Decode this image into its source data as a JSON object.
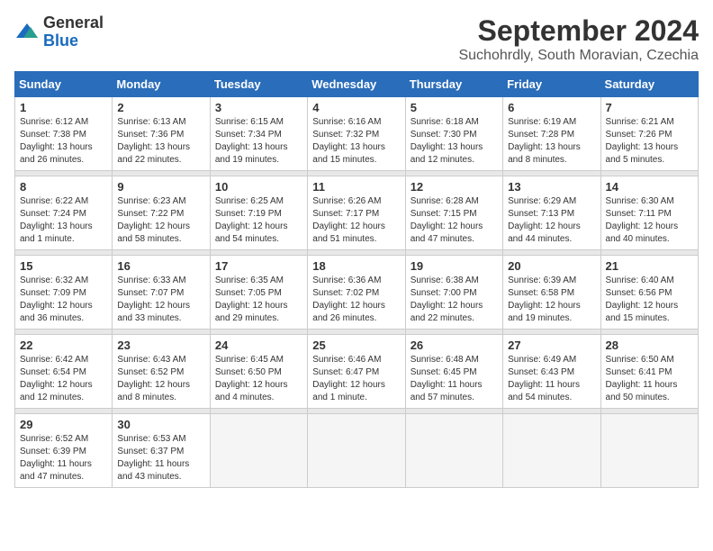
{
  "logo": {
    "general": "General",
    "blue": "Blue"
  },
  "title": "September 2024",
  "location": "Suchohrdly, South Moravian, Czechia",
  "days_of_week": [
    "Sunday",
    "Monday",
    "Tuesday",
    "Wednesday",
    "Thursday",
    "Friday",
    "Saturday"
  ],
  "weeks": [
    [
      {
        "day": 1,
        "info": "Sunrise: 6:12 AM\nSunset: 7:38 PM\nDaylight: 13 hours\nand 26 minutes."
      },
      {
        "day": 2,
        "info": "Sunrise: 6:13 AM\nSunset: 7:36 PM\nDaylight: 13 hours\nand 22 minutes."
      },
      {
        "day": 3,
        "info": "Sunrise: 6:15 AM\nSunset: 7:34 PM\nDaylight: 13 hours\nand 19 minutes."
      },
      {
        "day": 4,
        "info": "Sunrise: 6:16 AM\nSunset: 7:32 PM\nDaylight: 13 hours\nand 15 minutes."
      },
      {
        "day": 5,
        "info": "Sunrise: 6:18 AM\nSunset: 7:30 PM\nDaylight: 13 hours\nand 12 minutes."
      },
      {
        "day": 6,
        "info": "Sunrise: 6:19 AM\nSunset: 7:28 PM\nDaylight: 13 hours\nand 8 minutes."
      },
      {
        "day": 7,
        "info": "Sunrise: 6:21 AM\nSunset: 7:26 PM\nDaylight: 13 hours\nand 5 minutes."
      }
    ],
    [
      {
        "day": 8,
        "info": "Sunrise: 6:22 AM\nSunset: 7:24 PM\nDaylight: 13 hours\nand 1 minute."
      },
      {
        "day": 9,
        "info": "Sunrise: 6:23 AM\nSunset: 7:22 PM\nDaylight: 12 hours\nand 58 minutes."
      },
      {
        "day": 10,
        "info": "Sunrise: 6:25 AM\nSunset: 7:19 PM\nDaylight: 12 hours\nand 54 minutes."
      },
      {
        "day": 11,
        "info": "Sunrise: 6:26 AM\nSunset: 7:17 PM\nDaylight: 12 hours\nand 51 minutes."
      },
      {
        "day": 12,
        "info": "Sunrise: 6:28 AM\nSunset: 7:15 PM\nDaylight: 12 hours\nand 47 minutes."
      },
      {
        "day": 13,
        "info": "Sunrise: 6:29 AM\nSunset: 7:13 PM\nDaylight: 12 hours\nand 44 minutes."
      },
      {
        "day": 14,
        "info": "Sunrise: 6:30 AM\nSunset: 7:11 PM\nDaylight: 12 hours\nand 40 minutes."
      }
    ],
    [
      {
        "day": 15,
        "info": "Sunrise: 6:32 AM\nSunset: 7:09 PM\nDaylight: 12 hours\nand 36 minutes."
      },
      {
        "day": 16,
        "info": "Sunrise: 6:33 AM\nSunset: 7:07 PM\nDaylight: 12 hours\nand 33 minutes."
      },
      {
        "day": 17,
        "info": "Sunrise: 6:35 AM\nSunset: 7:05 PM\nDaylight: 12 hours\nand 29 minutes."
      },
      {
        "day": 18,
        "info": "Sunrise: 6:36 AM\nSunset: 7:02 PM\nDaylight: 12 hours\nand 26 minutes."
      },
      {
        "day": 19,
        "info": "Sunrise: 6:38 AM\nSunset: 7:00 PM\nDaylight: 12 hours\nand 22 minutes."
      },
      {
        "day": 20,
        "info": "Sunrise: 6:39 AM\nSunset: 6:58 PM\nDaylight: 12 hours\nand 19 minutes."
      },
      {
        "day": 21,
        "info": "Sunrise: 6:40 AM\nSunset: 6:56 PM\nDaylight: 12 hours\nand 15 minutes."
      }
    ],
    [
      {
        "day": 22,
        "info": "Sunrise: 6:42 AM\nSunset: 6:54 PM\nDaylight: 12 hours\nand 12 minutes."
      },
      {
        "day": 23,
        "info": "Sunrise: 6:43 AM\nSunset: 6:52 PM\nDaylight: 12 hours\nand 8 minutes."
      },
      {
        "day": 24,
        "info": "Sunrise: 6:45 AM\nSunset: 6:50 PM\nDaylight: 12 hours\nand 4 minutes."
      },
      {
        "day": 25,
        "info": "Sunrise: 6:46 AM\nSunset: 6:47 PM\nDaylight: 12 hours\nand 1 minute."
      },
      {
        "day": 26,
        "info": "Sunrise: 6:48 AM\nSunset: 6:45 PM\nDaylight: 11 hours\nand 57 minutes."
      },
      {
        "day": 27,
        "info": "Sunrise: 6:49 AM\nSunset: 6:43 PM\nDaylight: 11 hours\nand 54 minutes."
      },
      {
        "day": 28,
        "info": "Sunrise: 6:50 AM\nSunset: 6:41 PM\nDaylight: 11 hours\nand 50 minutes."
      }
    ],
    [
      {
        "day": 29,
        "info": "Sunrise: 6:52 AM\nSunset: 6:39 PM\nDaylight: 11 hours\nand 47 minutes."
      },
      {
        "day": 30,
        "info": "Sunrise: 6:53 AM\nSunset: 6:37 PM\nDaylight: 11 hours\nand 43 minutes."
      },
      null,
      null,
      null,
      null,
      null
    ]
  ]
}
